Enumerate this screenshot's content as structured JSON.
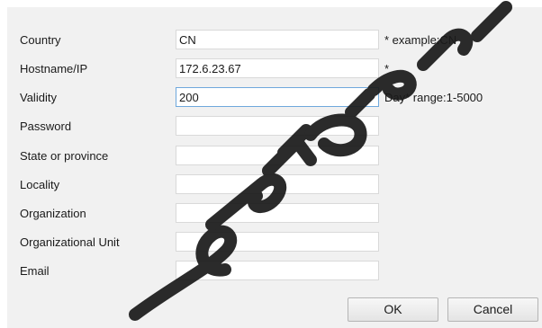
{
  "form": {
    "fields": [
      {
        "label": "Country",
        "value": "CN",
        "hint": "* example:CN"
      },
      {
        "label": "Hostname/IP",
        "value": "172.6.23.67",
        "hint": "*"
      },
      {
        "label": "Validity",
        "value": "200",
        "hint": "Day*  range:1-5000"
      },
      {
        "label": "Password",
        "value": "",
        "hint": ""
      },
      {
        "label": "State or province",
        "value": "",
        "hint": ""
      },
      {
        "label": "Locality",
        "value": "",
        "hint": ""
      },
      {
        "label": "Organization",
        "value": "",
        "hint": ""
      },
      {
        "label": "Organizational Unit",
        "value": "",
        "hint": ""
      },
      {
        "label": "Email",
        "value": "",
        "hint": ""
      }
    ]
  },
  "buttons": {
    "ok": "OK",
    "cancel": "Cancel"
  },
  "colors": {
    "background": "#f1f1f1",
    "focus_border": "#6fa8dc"
  }
}
